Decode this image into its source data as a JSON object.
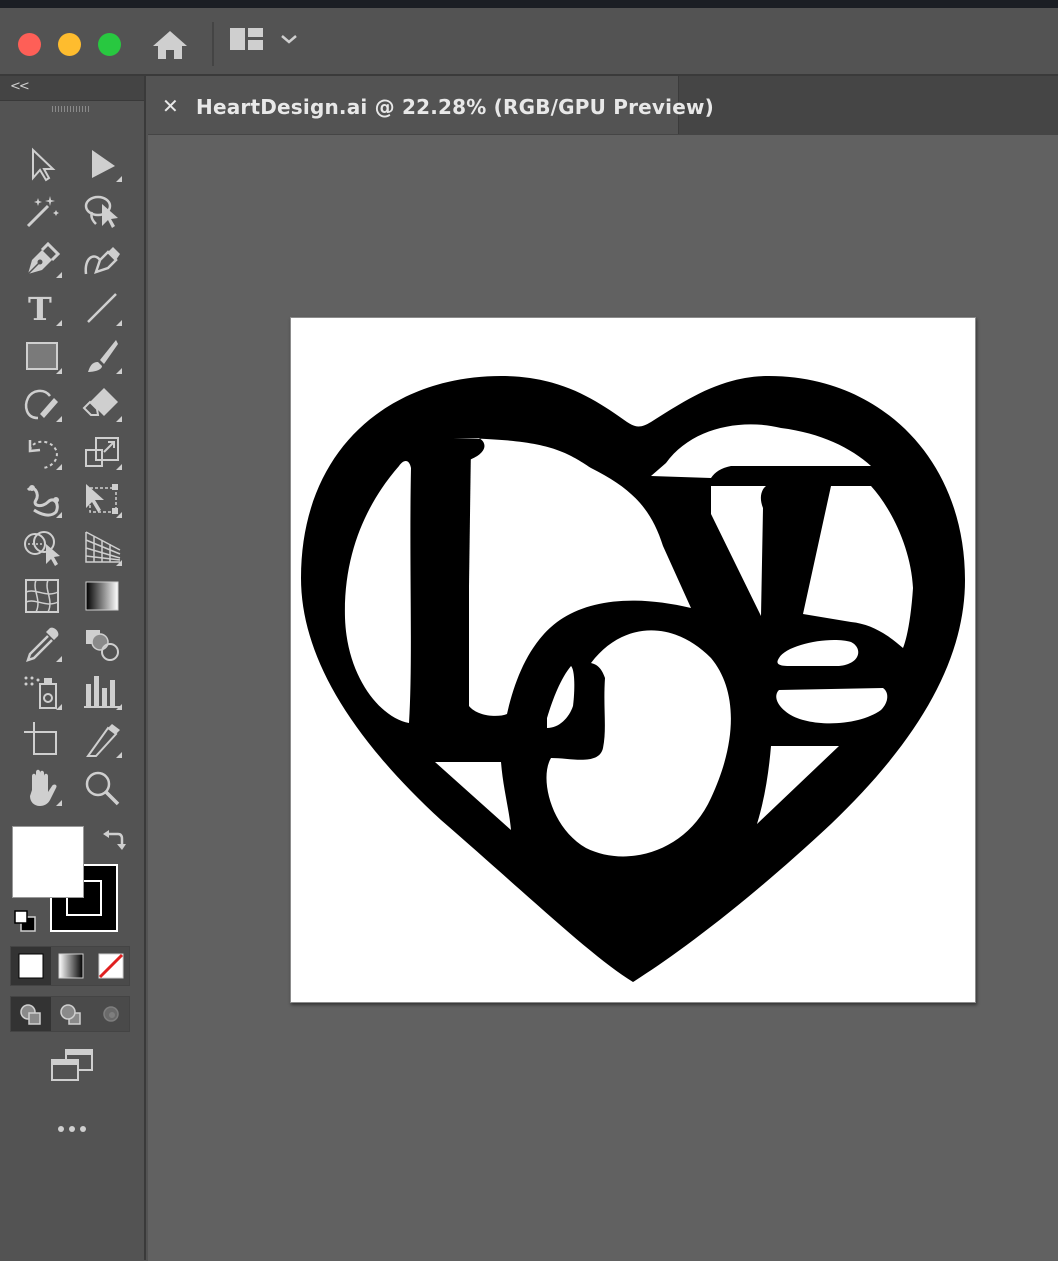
{
  "window": {
    "traffic_lights": [
      {
        "name": "close",
        "color": "#fe5f57"
      },
      {
        "name": "minimize",
        "color": "#febc2e"
      },
      {
        "name": "zoom",
        "color": "#28c840"
      }
    ],
    "toolbar": {
      "home_icon": "home-icon",
      "workspace_icon": "workspace-layout-icon",
      "workspace_chevron": "chevron-down-icon"
    }
  },
  "tools_panel": {
    "collapse_label": "<<",
    "tools": [
      {
        "name": "selection-tool",
        "icon": "selection-arrow-icon"
      },
      {
        "name": "direct-selection-tool",
        "icon": "direct-selection-arrow-icon"
      },
      {
        "name": "magic-wand-tool",
        "icon": "magic-wand-icon"
      },
      {
        "name": "lasso-tool",
        "icon": "lasso-icon"
      },
      {
        "name": "pen-tool",
        "icon": "pen-icon"
      },
      {
        "name": "curvature-tool",
        "icon": "curvature-pen-icon"
      },
      {
        "name": "type-tool",
        "icon": "type-icon",
        "glyph": "T"
      },
      {
        "name": "line-segment-tool",
        "icon": "line-icon"
      },
      {
        "name": "rectangle-tool",
        "icon": "rectangle-icon"
      },
      {
        "name": "paintbrush-tool",
        "icon": "paintbrush-icon"
      },
      {
        "name": "shaper-tool",
        "icon": "shaper-icon"
      },
      {
        "name": "eraser-tool",
        "icon": "eraser-icon"
      },
      {
        "name": "rotate-tool",
        "icon": "rotate-icon"
      },
      {
        "name": "scale-tool",
        "icon": "scale-icon"
      },
      {
        "name": "puppet-warp-tool",
        "icon": "puppet-warp-icon"
      },
      {
        "name": "free-transform-tool",
        "icon": "free-transform-icon"
      },
      {
        "name": "shape-builder-tool",
        "icon": "shape-builder-icon"
      },
      {
        "name": "perspective-grid-tool",
        "icon": "perspective-grid-icon"
      },
      {
        "name": "mesh-tool",
        "icon": "mesh-icon"
      },
      {
        "name": "gradient-tool",
        "icon": "gradient-icon"
      },
      {
        "name": "eyedropper-tool",
        "icon": "eyedropper-icon"
      },
      {
        "name": "blend-tool",
        "icon": "blend-icon"
      },
      {
        "name": "symbol-sprayer-tool",
        "icon": "symbol-sprayer-icon"
      },
      {
        "name": "column-graph-tool",
        "icon": "column-graph-icon"
      },
      {
        "name": "artboard-tool",
        "icon": "artboard-icon"
      },
      {
        "name": "slice-tool",
        "icon": "slice-knife-icon"
      },
      {
        "name": "hand-tool",
        "icon": "hand-icon"
      },
      {
        "name": "zoom-tool",
        "icon": "zoom-magnifier-icon"
      }
    ],
    "fill_color": "#ffffff",
    "stroke_color": "#000000",
    "color_modes": [
      "color-mode-icon",
      "gradient-mode-icon",
      "none-mode-icon"
    ],
    "drawing_modes": [
      "draw-normal-icon",
      "draw-behind-icon",
      "draw-inside-icon"
    ],
    "screen_mode_icon": "screen-mode-icon",
    "more_icon": "more-tools-icon"
  },
  "document": {
    "tab_close": "✕",
    "tab_title": "HeartDesign.ai @ 22.28% (RGB/GPU Preview)"
  },
  "artboard": {
    "background": "#ffffff",
    "artwork_color": "#000000",
    "artwork_icon": "heart-love-artwork"
  }
}
